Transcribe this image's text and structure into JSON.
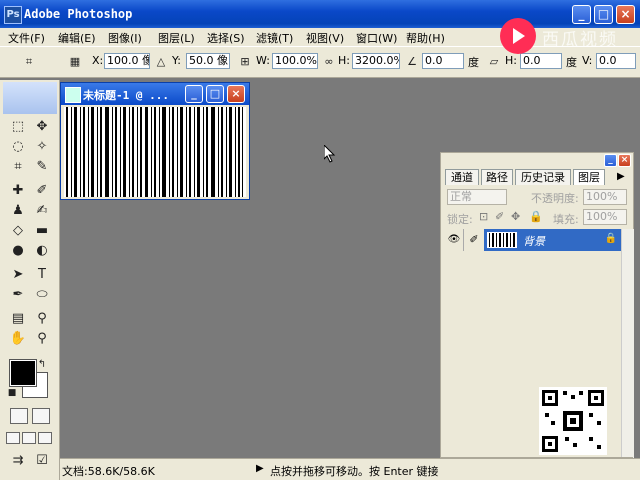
{
  "app": {
    "title": "Adobe Photoshop",
    "icon": "photoshop-icon",
    "controls": {
      "minimize": "_",
      "maximize": "□",
      "close": "×"
    }
  },
  "watermark": {
    "text": "西瓜视频",
    "icon": "play-logo-icon",
    "color": "#ff2d55"
  },
  "menu": [
    "文件(F)",
    "编辑(E)",
    "图像(I)",
    "图层(L)",
    "选择(S)",
    "滤镜(T)",
    "视图(V)",
    "窗口(W)",
    "帮助(H)"
  ],
  "options": {
    "x_label": "X:",
    "x_value": "100.0 像",
    "y_label": "Y:",
    "y_value": "50.0 像",
    "w_label": "W:",
    "w_value": "100.0%",
    "h_label": "H:",
    "h_value": "3200.0%",
    "angle_value": "0.0",
    "angle_unit": "度",
    "skew_h_label": "H:",
    "skew_h_value": "0.0",
    "skew_unit": "度",
    "skew_v_label": "V:",
    "skew_v_value": "0.0"
  },
  "document": {
    "title": "未标题-1 @ ...",
    "controls": {
      "minimize": "_",
      "maximize": "□",
      "close": "×"
    }
  },
  "palette": {
    "tabs": [
      "通道",
      "路径",
      "历史记录",
      "图层"
    ],
    "active_tab": "图层",
    "blend_mode": "正常",
    "opacity_label": "不透明度:",
    "opacity_value": "100%",
    "lock_label": "锁定:",
    "fill_label": "填充:",
    "fill_value": "100%",
    "layer_name": "背景",
    "controls": {
      "minimize": "_",
      "close": "×"
    }
  },
  "status": {
    "doc_size": "文档:58.6K/58.6K",
    "message": "点按并拖移可移动。按 Enter 键接受"
  },
  "colors": {
    "foreground": "#000000",
    "background": "#ffffff",
    "titlebar": "#0a48c8",
    "workspace": "#7a7a7a",
    "selection": "#316ac5"
  }
}
